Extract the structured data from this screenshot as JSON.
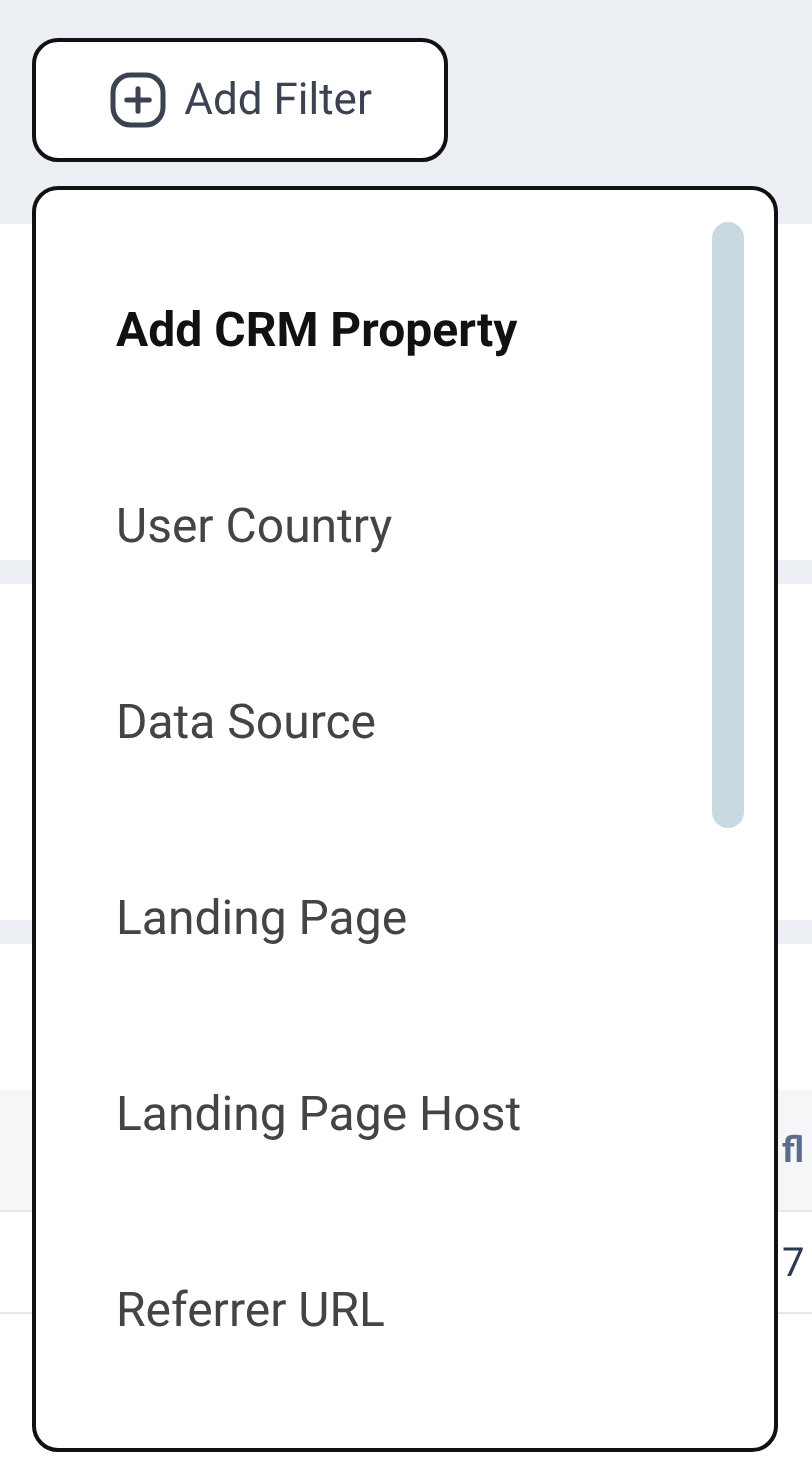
{
  "filter_button": {
    "label": "Add Filter"
  },
  "dropdown": {
    "items": [
      {
        "label": "Add CRM Property",
        "kind": "header"
      },
      {
        "label": "User Country",
        "kind": "option"
      },
      {
        "label": "Data Source",
        "kind": "option"
      },
      {
        "label": "Landing Page",
        "kind": "option"
      },
      {
        "label": "Landing Page Host",
        "kind": "option"
      },
      {
        "label": "Referrer URL",
        "kind": "option"
      }
    ]
  },
  "table": {
    "column_header": "fl",
    "cells": [
      "7"
    ]
  }
}
